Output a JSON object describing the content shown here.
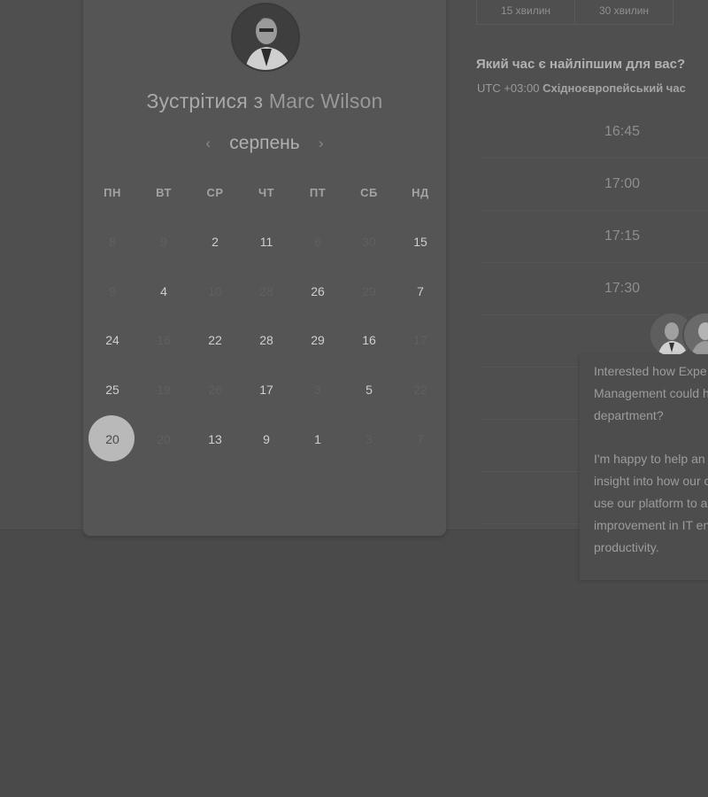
{
  "calendar": {
    "title_prefix": "Зустрітися з",
    "host_name": "Marc Wilson",
    "month": "серпень",
    "weekdays": [
      "ПН",
      "ВТ",
      "СР",
      "ЧТ",
      "ПТ",
      "СБ",
      "НД"
    ],
    "days": [
      {
        "label": "8",
        "state": "muted"
      },
      {
        "label": "9",
        "state": "muted"
      },
      {
        "label": "2",
        "state": "active"
      },
      {
        "label": "11",
        "state": "active"
      },
      {
        "label": "6",
        "state": "muted"
      },
      {
        "label": "30",
        "state": "muted"
      },
      {
        "label": "15",
        "state": "active"
      },
      {
        "label": "9",
        "state": "muted"
      },
      {
        "label": "4",
        "state": "active"
      },
      {
        "label": "10",
        "state": "muted"
      },
      {
        "label": "28",
        "state": "muted"
      },
      {
        "label": "26",
        "state": "active"
      },
      {
        "label": "29",
        "state": "muted"
      },
      {
        "label": "7",
        "state": "active"
      },
      {
        "label": "24",
        "state": "active"
      },
      {
        "label": "16",
        "state": "muted"
      },
      {
        "label": "22",
        "state": "active"
      },
      {
        "label": "28",
        "state": "active"
      },
      {
        "label": "29",
        "state": "active"
      },
      {
        "label": "16",
        "state": "active"
      },
      {
        "label": "17",
        "state": "muted"
      },
      {
        "label": "25",
        "state": "active"
      },
      {
        "label": "19",
        "state": "muted"
      },
      {
        "label": "26",
        "state": "muted"
      },
      {
        "label": "17",
        "state": "active"
      },
      {
        "label": "3",
        "state": "muted"
      },
      {
        "label": "5",
        "state": "active"
      },
      {
        "label": "22",
        "state": "muted"
      },
      {
        "label": "20",
        "state": "selected"
      },
      {
        "label": "20",
        "state": "muted"
      },
      {
        "label": "13",
        "state": "active"
      },
      {
        "label": "9",
        "state": "active"
      },
      {
        "label": "1",
        "state": "active"
      },
      {
        "label": "3",
        "state": "muted"
      },
      {
        "label": "7",
        "state": "muted"
      }
    ]
  },
  "durations": [
    "15 хвилин",
    "30 хвилин"
  ],
  "schedule": {
    "question": "Який час є найліпшим для вас?",
    "tz_offset": "UTC +03:00",
    "tz_name": "Східноєвропейський час",
    "slots": [
      "16:45",
      "17:00",
      "17:15",
      "17:30",
      "",
      "",
      "",
      ""
    ]
  },
  "chat": {
    "lines_p1": [
      "Interested how Expe",
      "Management could h",
      "department?"
    ],
    "lines_p2": [
      "I'm happy to help an",
      "insight into how our c",
      "use our platform to a",
      "improvement in IT en",
      "productivity."
    ]
  },
  "colors": {
    "selected_day": "#b9b9b9",
    "overlay": "#4a4a4a"
  }
}
